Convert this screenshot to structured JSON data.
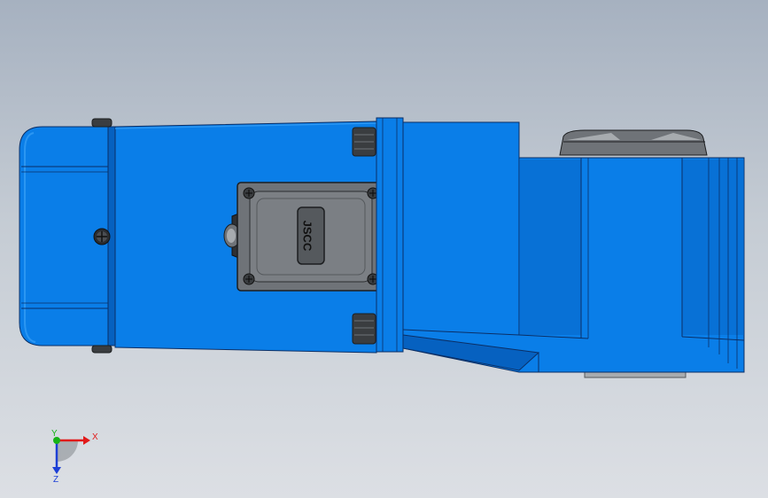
{
  "model": {
    "label_plate_text": "JSCC",
    "body_color": "#0a7ee8",
    "body_dark": "#0661c0",
    "body_light": "#2b96f2",
    "edge_color": "#0b2f66",
    "grey_part_color": "#6f7378",
    "grey_dark": "#3a3d40",
    "grey_light": "#a7abaf"
  },
  "viewport": {
    "background_top": "#a6b1c0",
    "background_bottom": "#dcdfe4"
  },
  "triad": {
    "x_label": "X",
    "y_label": "Y",
    "z_label": "Z",
    "x_color": "#e11a1a",
    "y_color": "#16b316",
    "z_color": "#1c3fd6"
  }
}
